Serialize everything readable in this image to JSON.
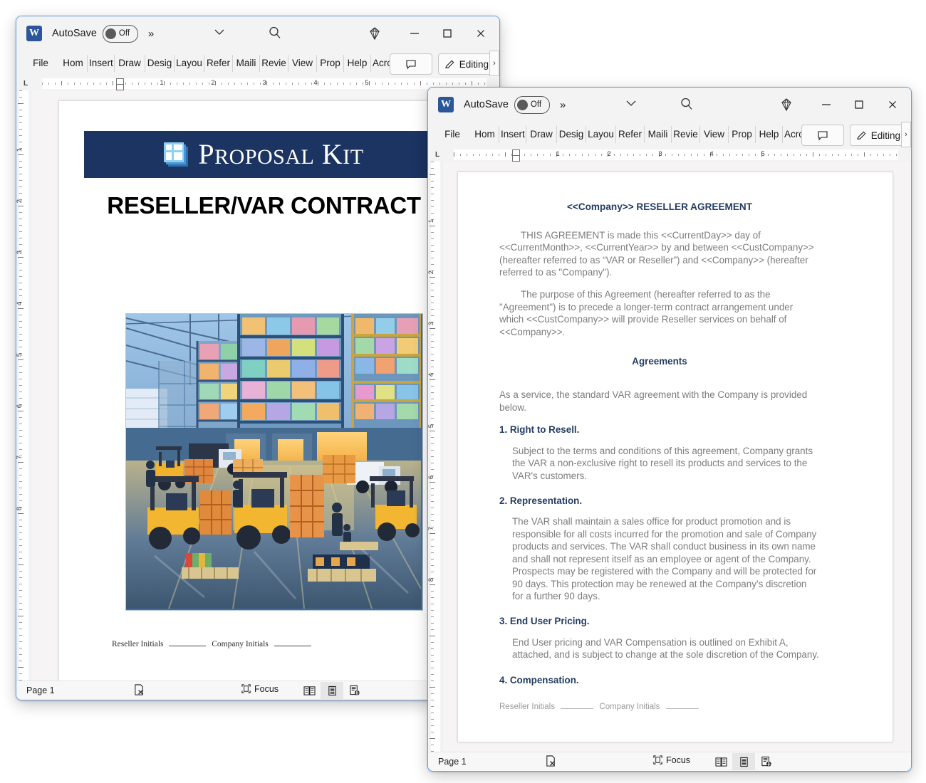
{
  "windows": [
    {
      "id": "word-back",
      "titlebar": {
        "app_icon": "word-logo-icon",
        "autosave_label": "AutoSave",
        "autosave_state": "Off",
        "more_chevron": "»",
        "dropdown_icon": "chevron-down-icon",
        "search_icon": "search-icon",
        "copilot_icon": "diamond-icon",
        "minimize_icon": "minimize-icon",
        "maximize_icon": "maximize-icon",
        "close_icon": "close-icon"
      },
      "ribbon": {
        "tabs": [
          "File",
          "Hom",
          "Insert",
          "Draw",
          "Desig",
          "Layou",
          "Refer",
          "Maili",
          "Revie",
          "View",
          "Prop",
          "Help",
          "Acrob"
        ],
        "comments_icon": "comment-icon",
        "editing_label": "Editing",
        "editing_icon": "pencil-icon",
        "expand_chevron": "›"
      },
      "ruler": {
        "left_tab_marker": "L",
        "numbers": [
          "1",
          "2",
          "3",
          "4",
          "5"
        ]
      },
      "vertical_ruler_numbers": [
        "1",
        "2",
        "3",
        "4",
        "5",
        "6",
        "7",
        "8"
      ],
      "statusbar": {
        "page_label": "Page 1",
        "accessibility_icon": "accessibility-checker-icon",
        "focus_label": "Focus",
        "focus_icon": "focus-mode-icon",
        "view_read_icon": "read-mode-icon",
        "view_print_icon": "print-layout-icon",
        "view_web_icon": "web-layout-icon",
        "active_view": "print-layout"
      },
      "document": {
        "banner_text_1": "P",
        "banner_text_2": "ROPOSAL",
        "banner_text_3": "K",
        "banner_text_4": "I",
        "banner_text_5": "T",
        "banner_full": "PROPOSAL KIT",
        "banner_color": "#1b3462",
        "title": "RESELLER/VAR CONTRACT",
        "image_alt": "warehouse-illustration",
        "footer_reseller": "Reseller Initials",
        "footer_company": "Company Initials"
      }
    },
    {
      "id": "word-front",
      "titlebar": {
        "app_icon": "word-logo-icon",
        "autosave_label": "AutoSave",
        "autosave_state": "Off",
        "more_chevron": "»",
        "dropdown_icon": "chevron-down-icon",
        "search_icon": "search-icon",
        "copilot_icon": "diamond-icon",
        "minimize_icon": "minimize-icon",
        "maximize_icon": "maximize-icon",
        "close_icon": "close-icon"
      },
      "ribbon": {
        "tabs": [
          "File",
          "Hom",
          "Insert",
          "Draw",
          "Desig",
          "Layou",
          "Refer",
          "Maili",
          "Revie",
          "View",
          "Prop",
          "Help",
          "Acrob"
        ],
        "comments_icon": "comment-icon",
        "editing_label": "Editing",
        "editing_icon": "pencil-icon",
        "expand_chevron": "›"
      },
      "ruler": {
        "left_tab_marker": "L",
        "numbers": [
          "1",
          "2",
          "3",
          "4",
          "5"
        ]
      },
      "vertical_ruler_numbers": [
        "1",
        "2",
        "3",
        "4",
        "5",
        "6",
        "7",
        "8"
      ],
      "statusbar": {
        "page_label": "Page 1",
        "accessibility_icon": "accessibility-checker-icon",
        "focus_label": "Focus",
        "focus_icon": "focus-mode-icon",
        "view_read_icon": "read-mode-icon",
        "view_print_icon": "print-layout-icon",
        "view_web_icon": "web-layout-icon",
        "active_view": "print-layout"
      },
      "document": {
        "heading": "<<Company>> RESELLER AGREEMENT",
        "para1": "THIS AGREEMENT is made this <<CurrentDay>> day of <<CurrentMonth>>, <<CurrentYear>> by and between <<CustCompany>> (hereafter referred to as “VAR or Reseller”) and <<Company>> (hereafter referred to as \"Company\").",
        "para2": "The purpose of this Agreement (hereafter referred to as the \"Agreement\") is to precede a longer-term contract arrangement under which <<CustCompany>> will provide Reseller services on behalf of <<Company>>.",
        "agreements_heading": "Agreements",
        "para3": "As a service, the standard VAR agreement with the Company is provided below.",
        "section1_title": "1. Right to Resell.",
        "section1_body": "Subject to the terms and conditions of this agreement, Company grants the VAR a non-exclusive right to resell its products and services to the VAR's customers.",
        "section2_title": "2. Representation.",
        "section2_body": "The VAR shall maintain a sales office for product promotion and is responsible for all costs incurred for the promotion and sale of Company products and services. The VAR shall conduct business in its own name and shall not represent itself as an employee or agent of the Company. Prospects may be registered with the Company and will be protected for 90 days. This protection may be renewed at the Company’s discretion for a further 90 days.",
        "section3_title": "3. End User Pricing.",
        "section3_body": "End User pricing and VAR Compensation is outlined on Exhibit A, attached, and is subject to change at the sole discretion of the Company.",
        "section4_title": "4. Compensation.",
        "footer_reseller": "Reseller Initials",
        "footer_company": "Company Initials"
      }
    }
  ],
  "colors": {
    "word_blue": "#2b579a",
    "banner_navy": "#1b3462",
    "heading_navy": "#243d63",
    "body_gray": "#7c7c80",
    "window_border": "#6a9bd8"
  }
}
